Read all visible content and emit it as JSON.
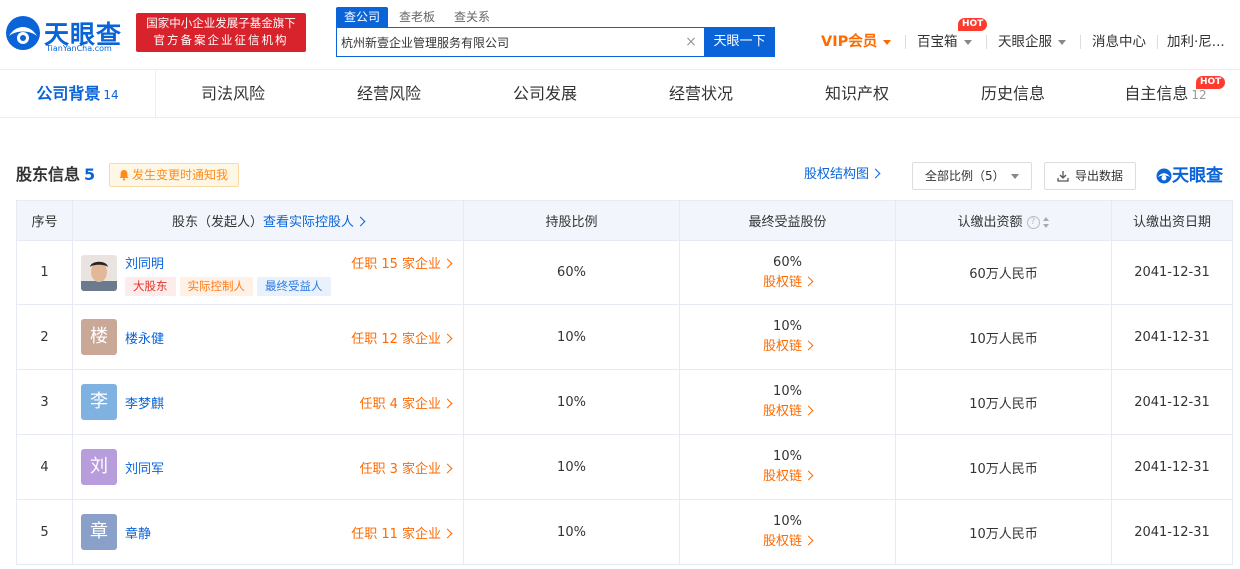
{
  "header": {
    "logo_text": "天眼查",
    "logo_sub": "TianYanCha.com",
    "fund_badge_line1": "国家中小企业发展子基金旗下",
    "fund_badge_line2": "官方备案企业征信机构",
    "search_tabs": [
      "查公司",
      "查老板",
      "查关系"
    ],
    "search_value": "杭州新壹企业管理服务有限公司",
    "search_button": "天眼一下",
    "nav": {
      "vip": "VIP会员",
      "baibaoxiang": "百宝箱",
      "qifu": "天眼企服",
      "messages": "消息中心",
      "user": "加利·尼..."
    },
    "hot_label": "HOT"
  },
  "mainnav": {
    "items": [
      {
        "label": "公司背景",
        "count": "14"
      },
      {
        "label": "司法风险",
        "count": ""
      },
      {
        "label": "经营风险",
        "count": ""
      },
      {
        "label": "公司发展",
        "count": ""
      },
      {
        "label": "经营状况",
        "count": ""
      },
      {
        "label": "知识产权",
        "count": ""
      },
      {
        "label": "历史信息",
        "count": ""
      },
      {
        "label": "自主信息",
        "count": "12"
      }
    ],
    "hot_label": "HOT"
  },
  "section": {
    "title": "股东信息",
    "count": "5",
    "notify": "发生变更时通知我",
    "equity_link": "股权结构图",
    "ratio_select": "全部比例（5）",
    "export": "导出数据",
    "watermark": "天眼查"
  },
  "table": {
    "headers": {
      "index": "序号",
      "holder": "股东（发起人）",
      "holder_link": "查看实际控股人",
      "ratio": "持股比例",
      "benefit": "最终受益股份",
      "capital": "认缴出资额",
      "date": "认缴出资日期"
    },
    "chain_label": "股权链",
    "rows": [
      {
        "index": "1",
        "name": "刘同明",
        "avatar_char": "",
        "avatar_color": "",
        "jobs": "任职 15 家企业",
        "tags": [
          "大股东",
          "实际控制人",
          "最终受益人"
        ],
        "ratio": "60%",
        "benefit": "60%",
        "capital": "60万人民币",
        "date": "2041-12-31"
      },
      {
        "index": "2",
        "name": "楼永健",
        "avatar_char": "楼",
        "avatar_color": "#c9a898",
        "jobs": "任职 12 家企业",
        "tags": [],
        "ratio": "10%",
        "benefit": "10%",
        "capital": "10万人民币",
        "date": "2041-12-31"
      },
      {
        "index": "3",
        "name": "李梦麒",
        "avatar_char": "李",
        "avatar_color": "#7fb2e0",
        "jobs": "任职 4 家企业",
        "tags": [],
        "ratio": "10%",
        "benefit": "10%",
        "capital": "10万人民币",
        "date": "2041-12-31"
      },
      {
        "index": "4",
        "name": "刘同军",
        "avatar_char": "刘",
        "avatar_color": "#b79ddc",
        "jobs": "任职 3 家企业",
        "tags": [],
        "ratio": "10%",
        "benefit": "10%",
        "capital": "10万人民币",
        "date": "2041-12-31"
      },
      {
        "index": "5",
        "name": "章静",
        "avatar_char": "章",
        "avatar_color": "#8aa0c8",
        "jobs": "任职 11 家企业",
        "tags": [],
        "ratio": "10%",
        "benefit": "10%",
        "capital": "10万人民币",
        "date": "2041-12-31"
      }
    ]
  },
  "colors": {
    "brand": "#0a64d8",
    "accent": "#ff6a00",
    "badge_red": "#d8222c"
  }
}
